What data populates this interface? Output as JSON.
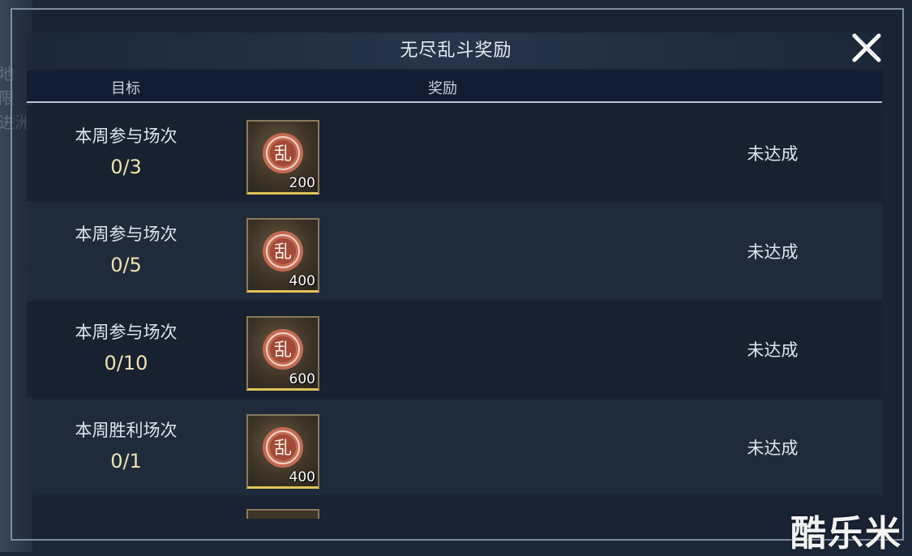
{
  "background_text": [
    "地",
    "限",
    "进洲"
  ],
  "dialog": {
    "title": "无尽乱斗奖励",
    "close_icon": "close-x-icon"
  },
  "columns": {
    "target": "目标",
    "reward": "奖励"
  },
  "rows": [
    {
      "goal": "本周参与场次",
      "progress": "0/3",
      "reward_icon": "luan-coin-icon",
      "coin_char": "乱",
      "quantity": "200",
      "status": "未达成"
    },
    {
      "goal": "本周参与场次",
      "progress": "0/5",
      "reward_icon": "luan-coin-icon",
      "coin_char": "乱",
      "quantity": "400",
      "status": "未达成"
    },
    {
      "goal": "本周参与场次",
      "progress": "0/10",
      "reward_icon": "luan-coin-icon",
      "coin_char": "乱",
      "quantity": "600",
      "status": "未达成"
    },
    {
      "goal": "本周胜利场次",
      "progress": "0/1",
      "reward_icon": "luan-coin-icon",
      "coin_char": "乱",
      "quantity": "400",
      "status": "未达成"
    }
  ],
  "watermark": "酷乐米",
  "colors": {
    "progress": "#f0e3b0",
    "item_border": "#e2c25a",
    "coin": "#c26a52"
  }
}
